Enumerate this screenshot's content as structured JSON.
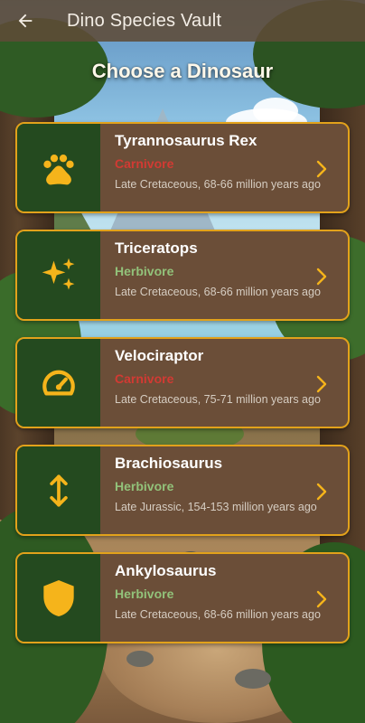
{
  "app_bar": {
    "title": "Dino Species Vault",
    "back_icon": "arrow-left-icon"
  },
  "heading": "Choose a Dinosaur",
  "colors": {
    "card_border": "#e2a21b",
    "icon_fill": "#f5b41b",
    "carnivore": "#d23a33",
    "herbivore": "#92c27a",
    "card_bg": "#6b4e38",
    "icon_bg": "#244a1f"
  },
  "dinosaurs": [
    {
      "name": "Tyrannosaurus Rex",
      "diet": "Carnivore",
      "era": "Late Cretaceous, 68-66 million years ago",
      "icon": "paw-icon"
    },
    {
      "name": "Triceratops",
      "diet": "Herbivore",
      "era": "Late Cretaceous, 68-66 million years ago",
      "icon": "sparkles-icon"
    },
    {
      "name": "Velociraptor",
      "diet": "Carnivore",
      "era": "Late Cretaceous, 75-71 million years ago",
      "icon": "speedometer-icon"
    },
    {
      "name": "Brachiosaurus",
      "diet": "Herbivore",
      "era": "Late Jurassic, 154-153 million years ago",
      "icon": "vertical-arrows-icon"
    },
    {
      "name": "Ankylosaurus",
      "diet": "Herbivore",
      "era": "Late Cretaceous, 68-66 million years ago",
      "icon": "shield-icon"
    }
  ]
}
